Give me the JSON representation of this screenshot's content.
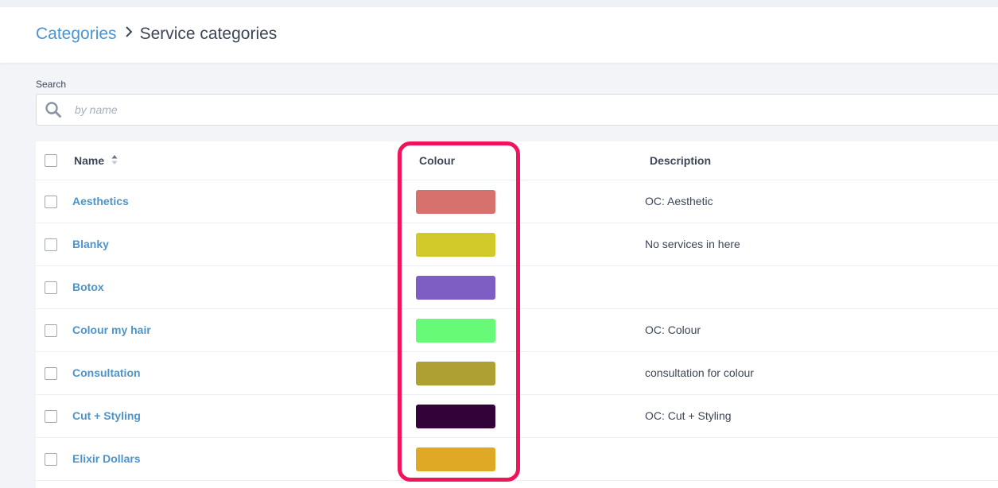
{
  "breadcrumb": {
    "parent": "Categories",
    "separator": "›",
    "current": "Service categories"
  },
  "search": {
    "label": "Search",
    "placeholder": "by name",
    "value": ""
  },
  "table": {
    "columns": {
      "name": "Name",
      "colour": "Colour",
      "description": "Description"
    },
    "rows": [
      {
        "name": "Aesthetics",
        "colour": "#d6716e",
        "description": "OC: Aesthetic"
      },
      {
        "name": "Blanky",
        "colour": "#d2c92b",
        "description": "No services in here"
      },
      {
        "name": "Botox",
        "colour": "#7f5ec4",
        "description": ""
      },
      {
        "name": "Colour my hair",
        "colour": "#67fa79",
        "description": "OC: Colour"
      },
      {
        "name": "Consultation",
        "colour": "#afa033",
        "description": "consultation for colour"
      },
      {
        "name": "Cut + Styling",
        "colour": "#330239",
        "description": "OC: Cut + Styling"
      },
      {
        "name": "Elixir Dollars",
        "colour": "#dfa926",
        "description": ""
      }
    ]
  },
  "colors": {
    "link": "#4d94cc",
    "highlight": "#f0145a",
    "text": "#3c4657"
  }
}
